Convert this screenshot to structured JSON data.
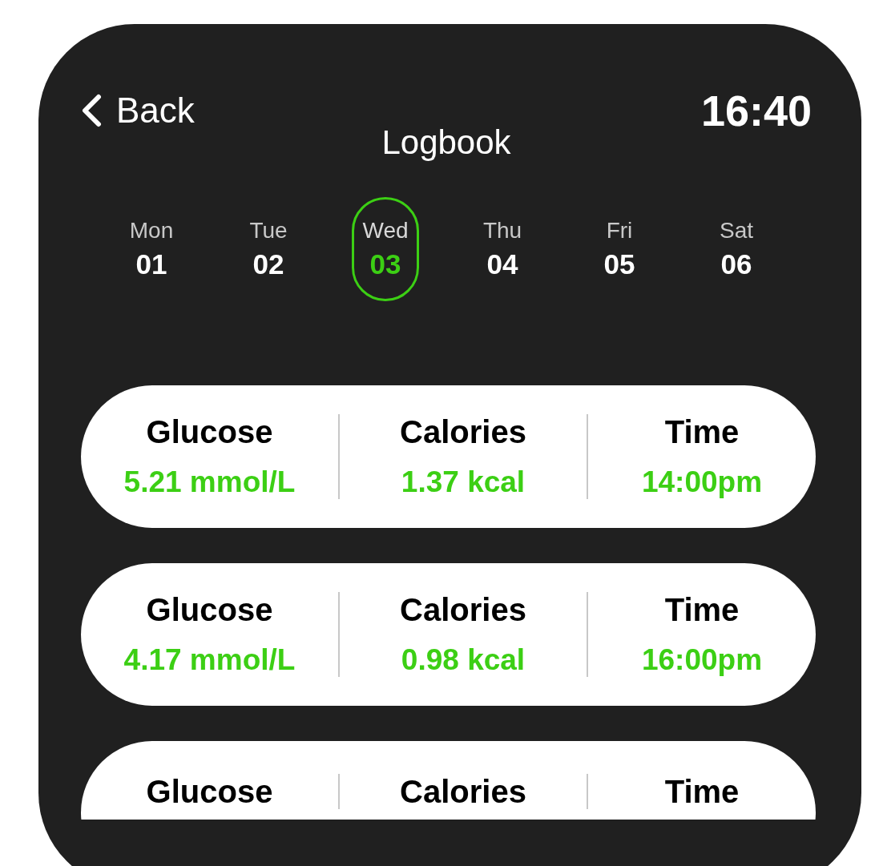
{
  "header": {
    "back": "Back",
    "title": "Logbook",
    "time": "16:40"
  },
  "days": [
    {
      "name": "Mon",
      "date": "01",
      "selected": false
    },
    {
      "name": "Tue",
      "date": "02",
      "selected": false
    },
    {
      "name": "Wed",
      "date": "03",
      "selected": true
    },
    {
      "name": "Thu",
      "date": "04",
      "selected": false
    },
    {
      "name": "Fri",
      "date": "05",
      "selected": false
    },
    {
      "name": "Sat",
      "date": "06",
      "selected": false
    }
  ],
  "entries": [
    {
      "columns": [
        {
          "label": "Glucose",
          "value": "5.21 mmol/L"
        },
        {
          "label": "Calories",
          "value": "1.37 kcal"
        },
        {
          "label": "Time",
          "value": "14:00pm"
        }
      ]
    },
    {
      "columns": [
        {
          "label": "Glucose",
          "value": "4.17 mmol/L"
        },
        {
          "label": "Calories",
          "value": "0.98 kcal"
        },
        {
          "label": "Time",
          "value": "16:00pm"
        }
      ]
    },
    {
      "columns": [
        {
          "label": "Glucose"
        },
        {
          "label": "Calories"
        },
        {
          "label": "Time"
        }
      ]
    }
  ]
}
